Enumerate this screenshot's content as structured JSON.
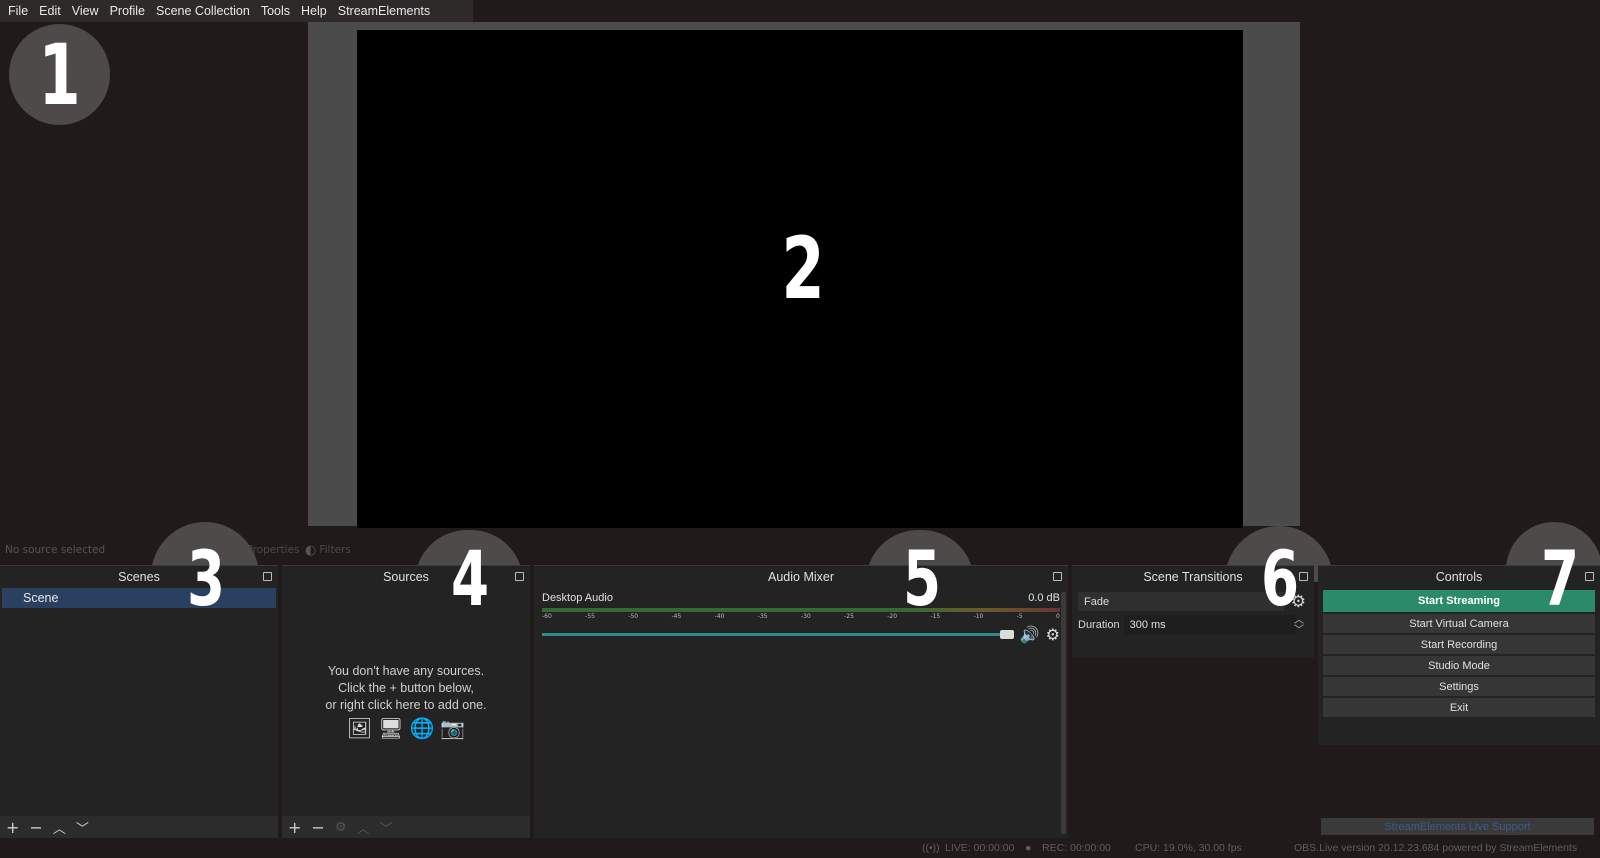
{
  "menu": [
    "File",
    "Edit",
    "View",
    "Profile",
    "Scene Collection",
    "Tools",
    "Help",
    "StreamElements"
  ],
  "badges": [
    "1",
    "2",
    "3",
    "4",
    "5",
    "6",
    "7"
  ],
  "source_toolbar": {
    "no_source": "No source selected",
    "properties": "Properties",
    "filters": "Filters"
  },
  "scenes": {
    "title": "Scenes",
    "items": [
      "Scene"
    ]
  },
  "sources": {
    "title": "Sources",
    "empty_line1": "You don't have any sources.",
    "empty_line2": "Click the + button below,",
    "empty_line3": "or right click here to add one."
  },
  "mixer": {
    "title": "Audio Mixer",
    "channel_name": "Desktop Audio",
    "channel_level": "0.0 dB",
    "ticks": [
      "-60",
      "-55",
      "-50",
      "-45",
      "-40",
      "-35",
      "-30",
      "-25",
      "-20",
      "-15",
      "-10",
      "-5",
      "0"
    ]
  },
  "transitions": {
    "title": "Scene Transitions",
    "selected": "Fade",
    "duration_label": "Duration",
    "duration_value": "300 ms"
  },
  "controls": {
    "title": "Controls",
    "start_streaming": "Start Streaming",
    "start_virtual_camera": "Start Virtual Camera",
    "start_recording": "Start Recording",
    "studio_mode": "Studio Mode",
    "settings": "Settings",
    "exit": "Exit",
    "support": "StreamElements Live Support"
  },
  "status": {
    "live": "LIVE: 00:00:00",
    "rec": "REC: 00:00:00",
    "cpu": "CPU: 19.0%, 30.00 fps",
    "version": "OBS.Live version 20.12.23.684 powered by StreamElements"
  },
  "colors": {
    "background": "#211a1a",
    "accent_stream": "#2a8a6a",
    "scene_selected": "#2a4060"
  }
}
